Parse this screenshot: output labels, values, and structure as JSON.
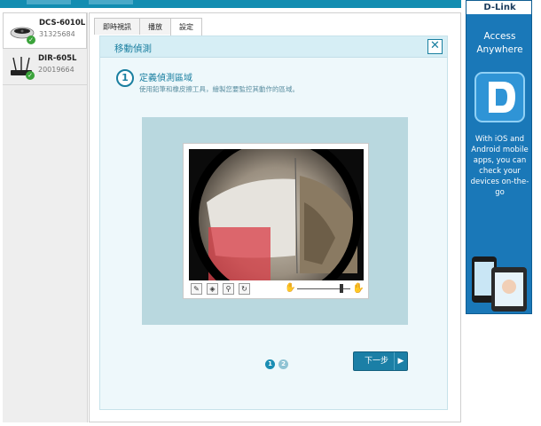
{
  "sidebar": {
    "devices": [
      {
        "name": "DCS-6010L",
        "sub": "31325684",
        "active": true,
        "icon": "camera-icon"
      },
      {
        "name": "DIR-605L",
        "sub": "20019664",
        "active": false,
        "icon": "router-icon"
      }
    ]
  },
  "tabs": [
    {
      "label": "即時視訊"
    },
    {
      "label": "播放"
    },
    {
      "label": "設定"
    }
  ],
  "panel": {
    "title": "移動偵測",
    "close_label": "✕",
    "step_number": "1",
    "step_title": "定義偵測區域",
    "step_desc": "使用鉛筆和橡皮擦工具，繪製您要監控其動作的區域。"
  },
  "pager": {
    "pages": [
      "1",
      "2"
    ],
    "current": "1"
  },
  "next_button": {
    "label": "下一步",
    "arrow": "▶"
  },
  "ad": {
    "brand": "D-Link",
    "headline": "Access Anywhere",
    "body": "With iOS and Android mobile apps, you can check your devices on-the-go"
  },
  "colors": {
    "accent": "#1a7fa0",
    "topbar": "#138db1",
    "ad_bg": "#1a78b8",
    "motion_area": "#d9434c"
  },
  "tool_icons": [
    "pencil-icon",
    "eraser-icon",
    "broom-icon",
    "rotate-icon"
  ]
}
